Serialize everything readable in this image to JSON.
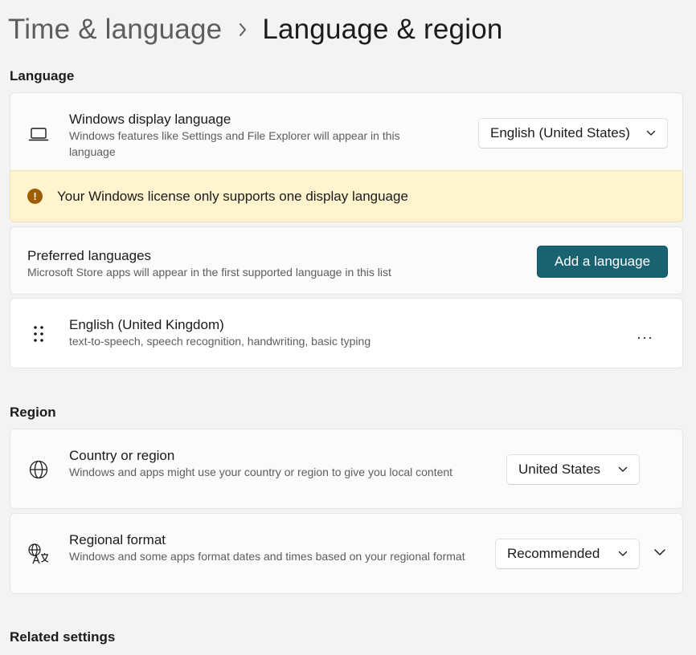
{
  "breadcrumb": {
    "parent": "Time & language",
    "separator": "›",
    "current": "Language & region"
  },
  "language_section": {
    "title": "Language",
    "display_language": {
      "title": "Windows display language",
      "description": "Windows features like Settings and File Explorer will appear in this language",
      "selected": "English (United States)",
      "icon": "laptop-icon"
    },
    "warning": {
      "text": "Your Windows license only supports one display language",
      "icon": "warning-icon"
    },
    "preferred": {
      "title": "Preferred languages",
      "description": "Microsoft Store apps will appear in the first supported language in this list",
      "button": "Add a language"
    },
    "languages": [
      {
        "name": "English (United Kingdom)",
        "features": "text-to-speech, speech recognition, handwriting, basic typing",
        "more": "···"
      }
    ]
  },
  "region_section": {
    "title": "Region",
    "country": {
      "title": "Country or region",
      "description": "Windows and apps might use your country or region to give you local content",
      "selected": "United States",
      "icon": "globe-icon"
    },
    "format": {
      "title": "Regional format",
      "description": "Windows and some apps format dates and times based on your regional format",
      "selected": "Recommended",
      "icon": "regional-format-icon"
    }
  },
  "related": {
    "title": "Related settings"
  },
  "colors": {
    "accent": "#186272",
    "warning_bg": "#fff4ce",
    "warning_icon": "#9d5d00"
  }
}
